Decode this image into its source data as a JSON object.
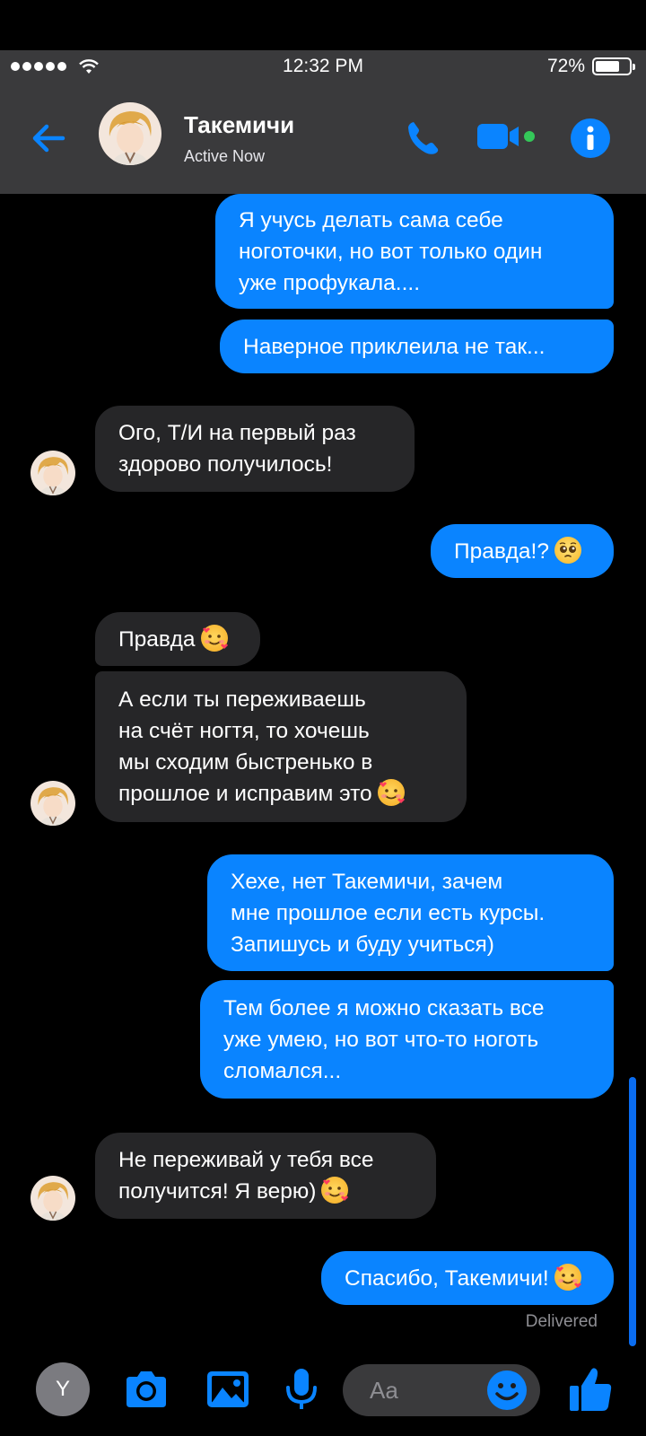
{
  "status_bar": {
    "time": "12:32 PM",
    "battery_text": "72%",
    "battery_level": 0.72
  },
  "header": {
    "contact_name": "Такемичи",
    "status": "Active Now"
  },
  "colors": {
    "accent": "#0a84ff",
    "incoming_bubble": "#262628",
    "header_bg": "#3a3a3c",
    "online": "#34c759"
  },
  "messages": [
    {
      "direction": "outgoing",
      "lines": [
        "Я учусь делать сама себе",
        "ноготочки, но вот только один",
        "уже профукала...."
      ]
    },
    {
      "direction": "outgoing",
      "lines": [
        "Наверное приклеила не так..."
      ]
    },
    {
      "direction": "incoming",
      "lines": [
        "Ого, Т/И на первый раз",
        "здорово получилось!"
      ]
    },
    {
      "direction": "outgoing",
      "lines": [
        "Правда!?"
      ],
      "emoji": "pleading-face"
    },
    {
      "direction": "incoming",
      "lines": [
        "Правда"
      ],
      "emoji": "smiling-face-with-hearts"
    },
    {
      "direction": "incoming",
      "lines": [
        "А если ты переживаешь",
        "на счёт ногтя, то хочешь",
        "мы сходим быстренько в",
        "прошлое и исправим это"
      ],
      "emoji": "smiling-face-with-hearts"
    },
    {
      "direction": "outgoing",
      "lines": [
        "Хехе, нет Такемичи, зачем",
        "мне прошлое если есть курсы.",
        "Запишусь и буду учиться)"
      ]
    },
    {
      "direction": "outgoing",
      "lines": [
        "Тем более я можно сказать все",
        "уже умею, но вот что-то ноготь",
        "сломался..."
      ]
    },
    {
      "direction": "incoming",
      "lines": [
        "Не переживай у тебя все",
        "получится! Я верю)"
      ],
      "emoji": "smiling-face-with-hearts"
    },
    {
      "direction": "outgoing",
      "lines": [
        "Спасибо, Такемичи!"
      ],
      "emoji": "smiling-face-with-hearts"
    }
  ],
  "delivery_status": "Delivered",
  "toolbar": {
    "user_initial": "Y",
    "composer_placeholder": "Aa"
  },
  "icons": [
    "back-arrow-icon",
    "phone-icon",
    "video-icon",
    "info-icon",
    "camera-icon",
    "image-icon",
    "microphone-icon",
    "smile-icon",
    "thumbs-up-icon"
  ]
}
